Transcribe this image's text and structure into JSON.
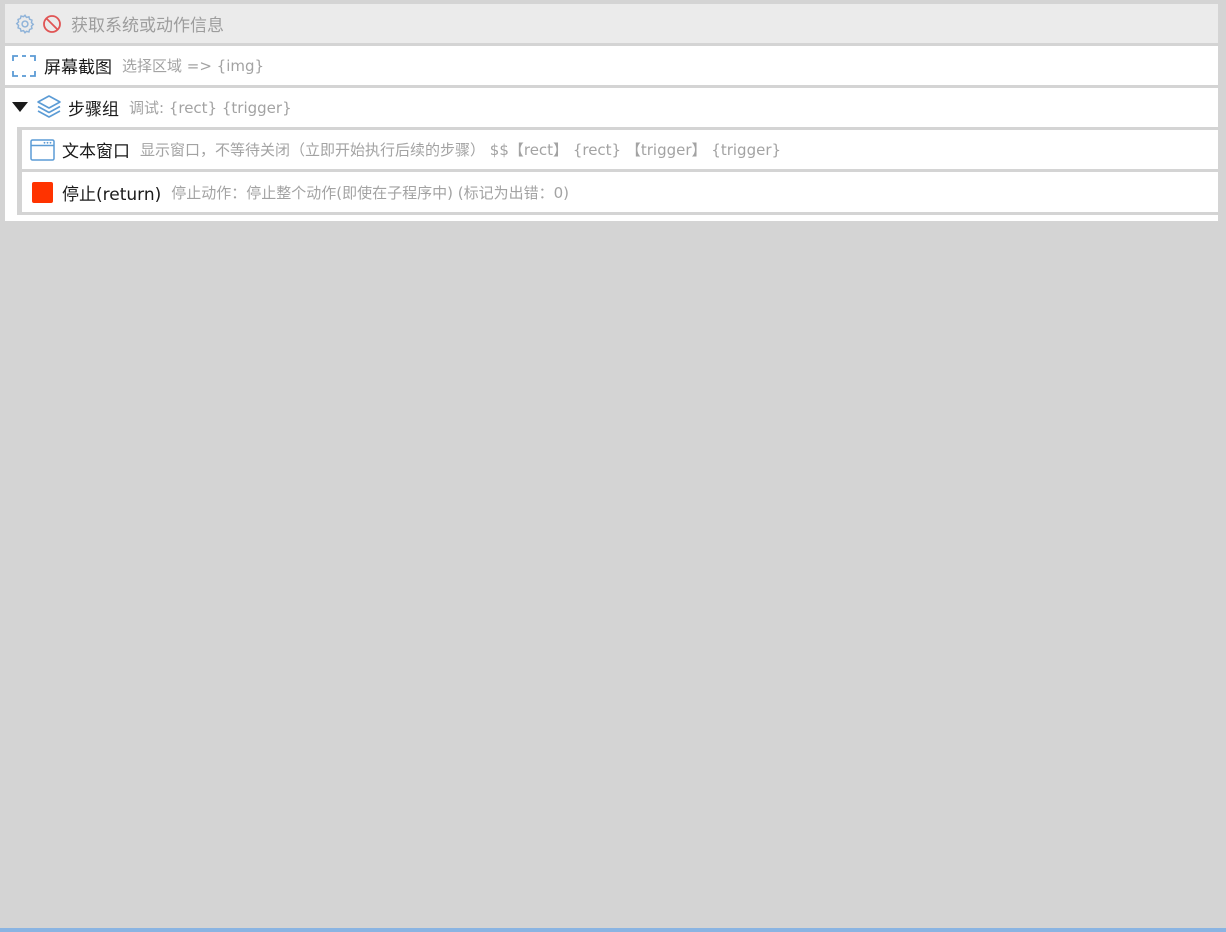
{
  "disabled_step": {
    "icon": "gear-icon",
    "status_icon": "prohibited-icon",
    "title": "获取系统或动作信息"
  },
  "screenshot_step": {
    "icon": "screenshot-selection-icon",
    "title": "屏幕截图",
    "description": "选择区域 => {img}"
  },
  "step_group": {
    "toggle_icon": "triangle-down-icon",
    "icon": "layers-icon",
    "title": "步骤组",
    "description": "调试: {rect} {trigger}",
    "children": [
      {
        "icon": "window-icon",
        "title": "文本窗口",
        "description": "显示窗口，不等待关闭（立即开始执行后续的步骤） $$【rect】 {rect} 【trigger】 {trigger}"
      },
      {
        "icon": "stop-square-icon",
        "icon_color": "#ff3300",
        "title": "停止(return)",
        "description": "停止动作：停止整个动作(即使在子程序中) (标记为出错：0)"
      }
    ]
  },
  "colors": {
    "accent_blue": "#5b9bd5",
    "disabled_red": "#e05555",
    "stop_red": "#ff3300",
    "bottom_bar": "#8ab4e2"
  }
}
